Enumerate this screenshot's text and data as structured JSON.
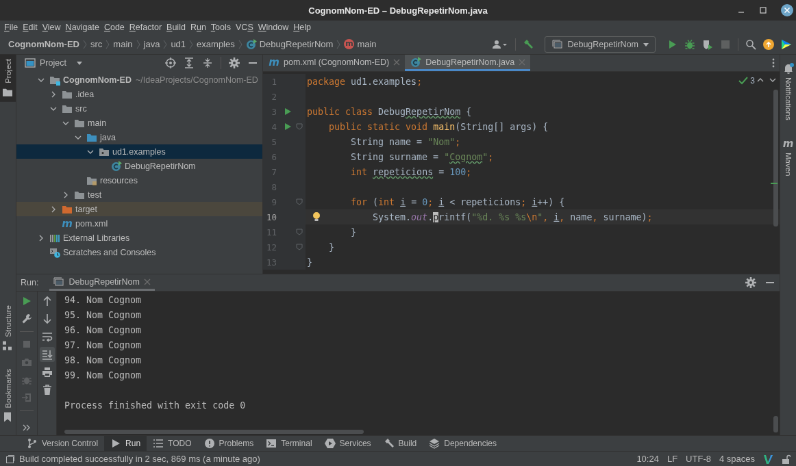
{
  "window": {
    "title": "CognomNom-ED – DebugRepetirNom.java"
  },
  "menu": [
    {
      "key": "F",
      "after": "ile"
    },
    {
      "key": "E",
      "after": "dit"
    },
    {
      "key": "V",
      "after": "iew"
    },
    {
      "key": "N",
      "after": "avigate"
    },
    {
      "key": "C",
      "after": "ode"
    },
    {
      "key": "R",
      "after": "efactor"
    },
    {
      "key": "B",
      "after": "uild"
    },
    {
      "before": "R",
      "key": "u",
      "after": "n"
    },
    {
      "key": "T",
      "after": "ools"
    },
    {
      "before": "VC",
      "key": "S"
    },
    {
      "key": "W",
      "after": "indow"
    },
    {
      "key": "H",
      "after": "elp"
    }
  ],
  "breadcrumbs": [
    {
      "label": "CognomNom-ED",
      "kind": "project"
    },
    {
      "label": "src",
      "kind": "dir"
    },
    {
      "label": "main",
      "kind": "dir"
    },
    {
      "label": "java",
      "kind": "dir"
    },
    {
      "label": "ud1",
      "kind": "dir"
    },
    {
      "label": "examples",
      "kind": "dir"
    },
    {
      "label": "DebugRepetirNom",
      "kind": "class"
    },
    {
      "label": "main",
      "kind": "method",
      "icon_glyph": "m"
    }
  ],
  "toolbar": {
    "run_config": "DebugRepetirNom"
  },
  "side_stripes": {
    "left_top": [
      {
        "label": "Project",
        "kind": "project",
        "selected": true
      }
    ],
    "left_bottom": [
      {
        "label": "Structure",
        "kind": "structure",
        "selected": false
      },
      {
        "label": "Bookmarks",
        "kind": "bookmarks",
        "selected": false
      }
    ],
    "right": [
      {
        "label": "Notifications",
        "kind": "notifications",
        "selected": false
      },
      {
        "label": "Maven",
        "kind": "maven",
        "icon_glyph": "m",
        "selected": false
      }
    ]
  },
  "project_panel": {
    "title": "Project",
    "tree": [
      {
        "label": "CognomNom-ED",
        "path": "~/IdeaProjects/CognomNom-ED",
        "kind": "module",
        "expanded": true,
        "selected": false,
        "children": [
          {
            "label": ".idea",
            "kind": "folder",
            "expanded": false,
            "selected": false
          },
          {
            "label": "src",
            "kind": "folder",
            "expanded": true,
            "selected": false,
            "children": [
              {
                "label": "main",
                "kind": "folder",
                "expanded": true,
                "selected": false,
                "children": [
                  {
                    "label": "java",
                    "kind": "source_root",
                    "expanded": true,
                    "selected": false,
                    "children": [
                      {
                        "label": "ud1.examples",
                        "kind": "package",
                        "expanded": true,
                        "selected": true,
                        "children": [
                          {
                            "label": "DebugRepetirNom",
                            "kind": "class",
                            "selected": false
                          }
                        ]
                      }
                    ]
                  },
                  {
                    "label": "resources",
                    "kind": "resources_root",
                    "selected": false
                  }
                ]
              },
              {
                "label": "test",
                "kind": "folder",
                "expanded": false,
                "selected": false
              }
            ]
          },
          {
            "label": "target",
            "kind": "excluded",
            "expanded": false,
            "selected": false
          },
          {
            "label": "pom.xml",
            "kind": "maven",
            "icon_glyph": "m",
            "selected": false
          }
        ]
      },
      {
        "label": "External Libraries",
        "kind": "libraries",
        "expanded": false,
        "selected": false
      },
      {
        "label": "Scratches and Consoles",
        "kind": "scratches",
        "selected": false
      }
    ]
  },
  "editor": {
    "tabs": [
      {
        "label": "pom.xml (CognomNom-ED)",
        "kind": "maven",
        "icon_glyph": "m",
        "selected": false
      },
      {
        "label": "DebugRepetirNom.java",
        "kind": "class",
        "selected": true
      }
    ],
    "inspections": "3",
    "lines": [
      {
        "number": "1",
        "current": false,
        "tokens": [
          {
            "t": "package",
            "kind": "kw"
          },
          {
            "t": " ud1.examples",
            "kind": "plain"
          },
          {
            "t": ";",
            "kind": "kw"
          }
        ]
      },
      {
        "number": "2",
        "current": false
      },
      {
        "number": "3",
        "current": false,
        "runnable": true,
        "tokens": [
          {
            "t": "public class ",
            "kind": "kw"
          },
          {
            "t": "Debug",
            "kind": "plain"
          },
          {
            "t": "RepetirNom",
            "kind": "typo"
          },
          {
            "t": " {",
            "kind": "plain"
          }
        ]
      },
      {
        "number": "4",
        "current": false,
        "runnable": true,
        "fold": true,
        "tokens": [
          {
            "t": "    public static void ",
            "kind": "kw"
          },
          {
            "t": "main",
            "kind": "decl"
          },
          {
            "t": "(String[] args) {",
            "kind": "plain"
          }
        ]
      },
      {
        "number": "5",
        "current": false,
        "tokens": [
          {
            "t": "        String name = ",
            "kind": "plain"
          },
          {
            "t": "\"Nom\"",
            "kind": "str"
          },
          {
            "t": ";",
            "kind": "kw"
          }
        ]
      },
      {
        "number": "6",
        "current": false,
        "tokens": [
          {
            "t": "        String surname = ",
            "kind": "plain"
          },
          {
            "t": "\"",
            "kind": "str"
          },
          {
            "t": "Cognom",
            "kind": "strtypo"
          },
          {
            "t": "\"",
            "kind": "str"
          },
          {
            "t": ";",
            "kind": "kw"
          }
        ]
      },
      {
        "number": "7",
        "current": false,
        "tokens": [
          {
            "t": "        int ",
            "kind": "kw"
          },
          {
            "t": "repeticions",
            "kind": "typo"
          },
          {
            "t": " = ",
            "kind": "plain"
          },
          {
            "t": "100",
            "kind": "num"
          },
          {
            "t": ";",
            "kind": "kw"
          }
        ]
      },
      {
        "number": "8",
        "current": false
      },
      {
        "number": "9",
        "current": false,
        "fold": true,
        "tokens": [
          {
            "t": "        for ",
            "kind": "kw"
          },
          {
            "t": "(",
            "kind": "plain"
          },
          {
            "t": "int ",
            "kind": "kw"
          },
          {
            "t": "i",
            "kind": "var"
          },
          {
            "t": " = ",
            "kind": "plain"
          },
          {
            "t": "0",
            "kind": "num"
          },
          {
            "t": "; ",
            "kind": "kw"
          },
          {
            "t": "i",
            "kind": "var"
          },
          {
            "t": " < repeticions",
            "kind": "plain"
          },
          {
            "t": "; ",
            "kind": "kw"
          },
          {
            "t": "i",
            "kind": "var"
          },
          {
            "t": "++) {",
            "kind": "plain"
          }
        ]
      },
      {
        "number": "10",
        "current": true,
        "intention": true,
        "tokens": [
          {
            "t": "            System.",
            "kind": "plain"
          },
          {
            "t": "out",
            "kind": "field"
          },
          {
            "t": ".",
            "kind": "plain"
          },
          {
            "t": "p",
            "kind": "caret"
          },
          {
            "t": "rintf(",
            "kind": "plain"
          },
          {
            "t": "\"%d. %s %s",
            "kind": "str"
          },
          {
            "t": "\\n",
            "kind": "esc"
          },
          {
            "t": "\"",
            "kind": "str"
          },
          {
            "t": ", ",
            "kind": "kw"
          },
          {
            "t": "i",
            "kind": "var"
          },
          {
            "t": ", ",
            "kind": "kw"
          },
          {
            "t": "name",
            "kind": "plain"
          },
          {
            "t": ", ",
            "kind": "kw"
          },
          {
            "t": "surname)",
            "kind": "plain"
          },
          {
            "t": ";",
            "kind": "kw"
          }
        ]
      },
      {
        "number": "11",
        "current": false,
        "fold": true,
        "tokens": [
          {
            "t": "        }",
            "kind": "plain"
          }
        ]
      },
      {
        "number": "12",
        "current": false,
        "fold": true,
        "tokens": [
          {
            "t": "    }",
            "kind": "plain"
          }
        ]
      },
      {
        "number": "13",
        "current": false,
        "tokens": [
          {
            "t": "}",
            "kind": "plain"
          }
        ]
      }
    ]
  },
  "run_panel": {
    "label": "Run:",
    "tab": "DebugRepetirNom",
    "left_tools": [
      {
        "kind": "rerun",
        "disabled": false
      },
      {
        "kind": "wrench",
        "disabled": false
      },
      {
        "kind": "separator"
      },
      {
        "kind": "stop",
        "disabled": true
      },
      {
        "kind": "camera",
        "disabled": true
      },
      {
        "kind": "debug",
        "disabled": true
      },
      {
        "kind": "login",
        "disabled": true
      },
      {
        "kind": "separator"
      }
    ],
    "right_tools": [
      {
        "kind": "up",
        "on": false
      },
      {
        "kind": "down",
        "on": false
      },
      {
        "kind": "wrap",
        "on": false
      },
      {
        "kind": "scroll_end",
        "on": true
      },
      {
        "kind": "print",
        "on": false
      },
      {
        "kind": "trash",
        "on": false
      }
    ],
    "output": [
      "94. Nom Cognom",
      "95. Nom Cognom",
      "96. Nom Cognom",
      "97. Nom Cognom",
      "98. Nom Cognom",
      "99. Nom Cognom"
    ],
    "exit_message": "Process finished with exit code 0"
  },
  "tool_windows": [
    {
      "label": "Version Control",
      "kind": "vcs",
      "selected": false
    },
    {
      "label": "Run",
      "kind": "run",
      "selected": true
    },
    {
      "label": "TODO",
      "kind": "todo",
      "selected": false
    },
    {
      "label": "Problems",
      "kind": "problems",
      "selected": false
    },
    {
      "label": "Terminal",
      "kind": "terminal",
      "selected": false
    },
    {
      "label": "Services",
      "kind": "services",
      "selected": false
    },
    {
      "label": "Build",
      "kind": "build",
      "selected": false
    },
    {
      "label": "Dependencies",
      "kind": "dependencies",
      "selected": false
    }
  ],
  "status_bar": {
    "message": "Build completed successfully in 2 sec, 869 ms (a minute ago)",
    "items": [
      "10:24",
      "LF",
      "UTF-8",
      "4 spaces"
    ]
  }
}
